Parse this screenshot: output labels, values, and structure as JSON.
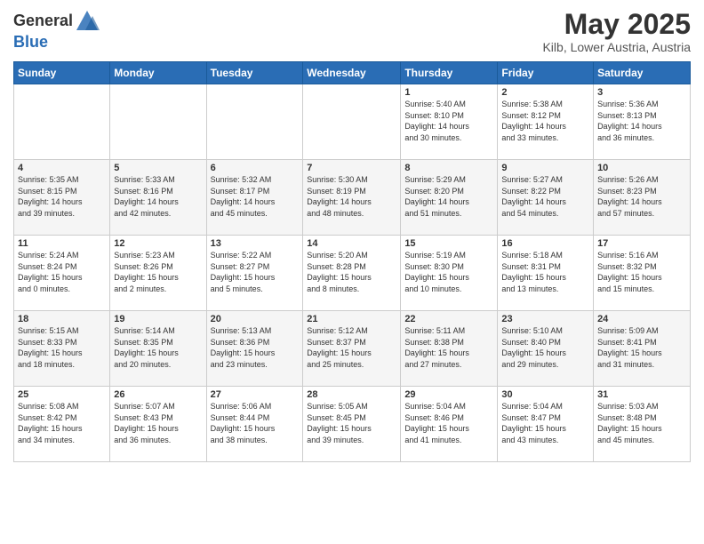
{
  "header": {
    "logo_general": "General",
    "logo_blue": "Blue",
    "month_title": "May 2025",
    "subtitle": "Kilb, Lower Austria, Austria"
  },
  "calendar": {
    "days_of_week": [
      "Sunday",
      "Monday",
      "Tuesday",
      "Wednesday",
      "Thursday",
      "Friday",
      "Saturday"
    ],
    "weeks": [
      [
        {
          "day": "",
          "info": ""
        },
        {
          "day": "",
          "info": ""
        },
        {
          "day": "",
          "info": ""
        },
        {
          "day": "",
          "info": ""
        },
        {
          "day": "1",
          "info": "Sunrise: 5:40 AM\nSunset: 8:10 PM\nDaylight: 14 hours\nand 30 minutes."
        },
        {
          "day": "2",
          "info": "Sunrise: 5:38 AM\nSunset: 8:12 PM\nDaylight: 14 hours\nand 33 minutes."
        },
        {
          "day": "3",
          "info": "Sunrise: 5:36 AM\nSunset: 8:13 PM\nDaylight: 14 hours\nand 36 minutes."
        }
      ],
      [
        {
          "day": "4",
          "info": "Sunrise: 5:35 AM\nSunset: 8:15 PM\nDaylight: 14 hours\nand 39 minutes."
        },
        {
          "day": "5",
          "info": "Sunrise: 5:33 AM\nSunset: 8:16 PM\nDaylight: 14 hours\nand 42 minutes."
        },
        {
          "day": "6",
          "info": "Sunrise: 5:32 AM\nSunset: 8:17 PM\nDaylight: 14 hours\nand 45 minutes."
        },
        {
          "day": "7",
          "info": "Sunrise: 5:30 AM\nSunset: 8:19 PM\nDaylight: 14 hours\nand 48 minutes."
        },
        {
          "day": "8",
          "info": "Sunrise: 5:29 AM\nSunset: 8:20 PM\nDaylight: 14 hours\nand 51 minutes."
        },
        {
          "day": "9",
          "info": "Sunrise: 5:27 AM\nSunset: 8:22 PM\nDaylight: 14 hours\nand 54 minutes."
        },
        {
          "day": "10",
          "info": "Sunrise: 5:26 AM\nSunset: 8:23 PM\nDaylight: 14 hours\nand 57 minutes."
        }
      ],
      [
        {
          "day": "11",
          "info": "Sunrise: 5:24 AM\nSunset: 8:24 PM\nDaylight: 15 hours\nand 0 minutes."
        },
        {
          "day": "12",
          "info": "Sunrise: 5:23 AM\nSunset: 8:26 PM\nDaylight: 15 hours\nand 2 minutes."
        },
        {
          "day": "13",
          "info": "Sunrise: 5:22 AM\nSunset: 8:27 PM\nDaylight: 15 hours\nand 5 minutes."
        },
        {
          "day": "14",
          "info": "Sunrise: 5:20 AM\nSunset: 8:28 PM\nDaylight: 15 hours\nand 8 minutes."
        },
        {
          "day": "15",
          "info": "Sunrise: 5:19 AM\nSunset: 8:30 PM\nDaylight: 15 hours\nand 10 minutes."
        },
        {
          "day": "16",
          "info": "Sunrise: 5:18 AM\nSunset: 8:31 PM\nDaylight: 15 hours\nand 13 minutes."
        },
        {
          "day": "17",
          "info": "Sunrise: 5:16 AM\nSunset: 8:32 PM\nDaylight: 15 hours\nand 15 minutes."
        }
      ],
      [
        {
          "day": "18",
          "info": "Sunrise: 5:15 AM\nSunset: 8:33 PM\nDaylight: 15 hours\nand 18 minutes."
        },
        {
          "day": "19",
          "info": "Sunrise: 5:14 AM\nSunset: 8:35 PM\nDaylight: 15 hours\nand 20 minutes."
        },
        {
          "day": "20",
          "info": "Sunrise: 5:13 AM\nSunset: 8:36 PM\nDaylight: 15 hours\nand 23 minutes."
        },
        {
          "day": "21",
          "info": "Sunrise: 5:12 AM\nSunset: 8:37 PM\nDaylight: 15 hours\nand 25 minutes."
        },
        {
          "day": "22",
          "info": "Sunrise: 5:11 AM\nSunset: 8:38 PM\nDaylight: 15 hours\nand 27 minutes."
        },
        {
          "day": "23",
          "info": "Sunrise: 5:10 AM\nSunset: 8:40 PM\nDaylight: 15 hours\nand 29 minutes."
        },
        {
          "day": "24",
          "info": "Sunrise: 5:09 AM\nSunset: 8:41 PM\nDaylight: 15 hours\nand 31 minutes."
        }
      ],
      [
        {
          "day": "25",
          "info": "Sunrise: 5:08 AM\nSunset: 8:42 PM\nDaylight: 15 hours\nand 34 minutes."
        },
        {
          "day": "26",
          "info": "Sunrise: 5:07 AM\nSunset: 8:43 PM\nDaylight: 15 hours\nand 36 minutes."
        },
        {
          "day": "27",
          "info": "Sunrise: 5:06 AM\nSunset: 8:44 PM\nDaylight: 15 hours\nand 38 minutes."
        },
        {
          "day": "28",
          "info": "Sunrise: 5:05 AM\nSunset: 8:45 PM\nDaylight: 15 hours\nand 39 minutes."
        },
        {
          "day": "29",
          "info": "Sunrise: 5:04 AM\nSunset: 8:46 PM\nDaylight: 15 hours\nand 41 minutes."
        },
        {
          "day": "30",
          "info": "Sunrise: 5:04 AM\nSunset: 8:47 PM\nDaylight: 15 hours\nand 43 minutes."
        },
        {
          "day": "31",
          "info": "Sunrise: 5:03 AM\nSunset: 8:48 PM\nDaylight: 15 hours\nand 45 minutes."
        }
      ]
    ]
  }
}
